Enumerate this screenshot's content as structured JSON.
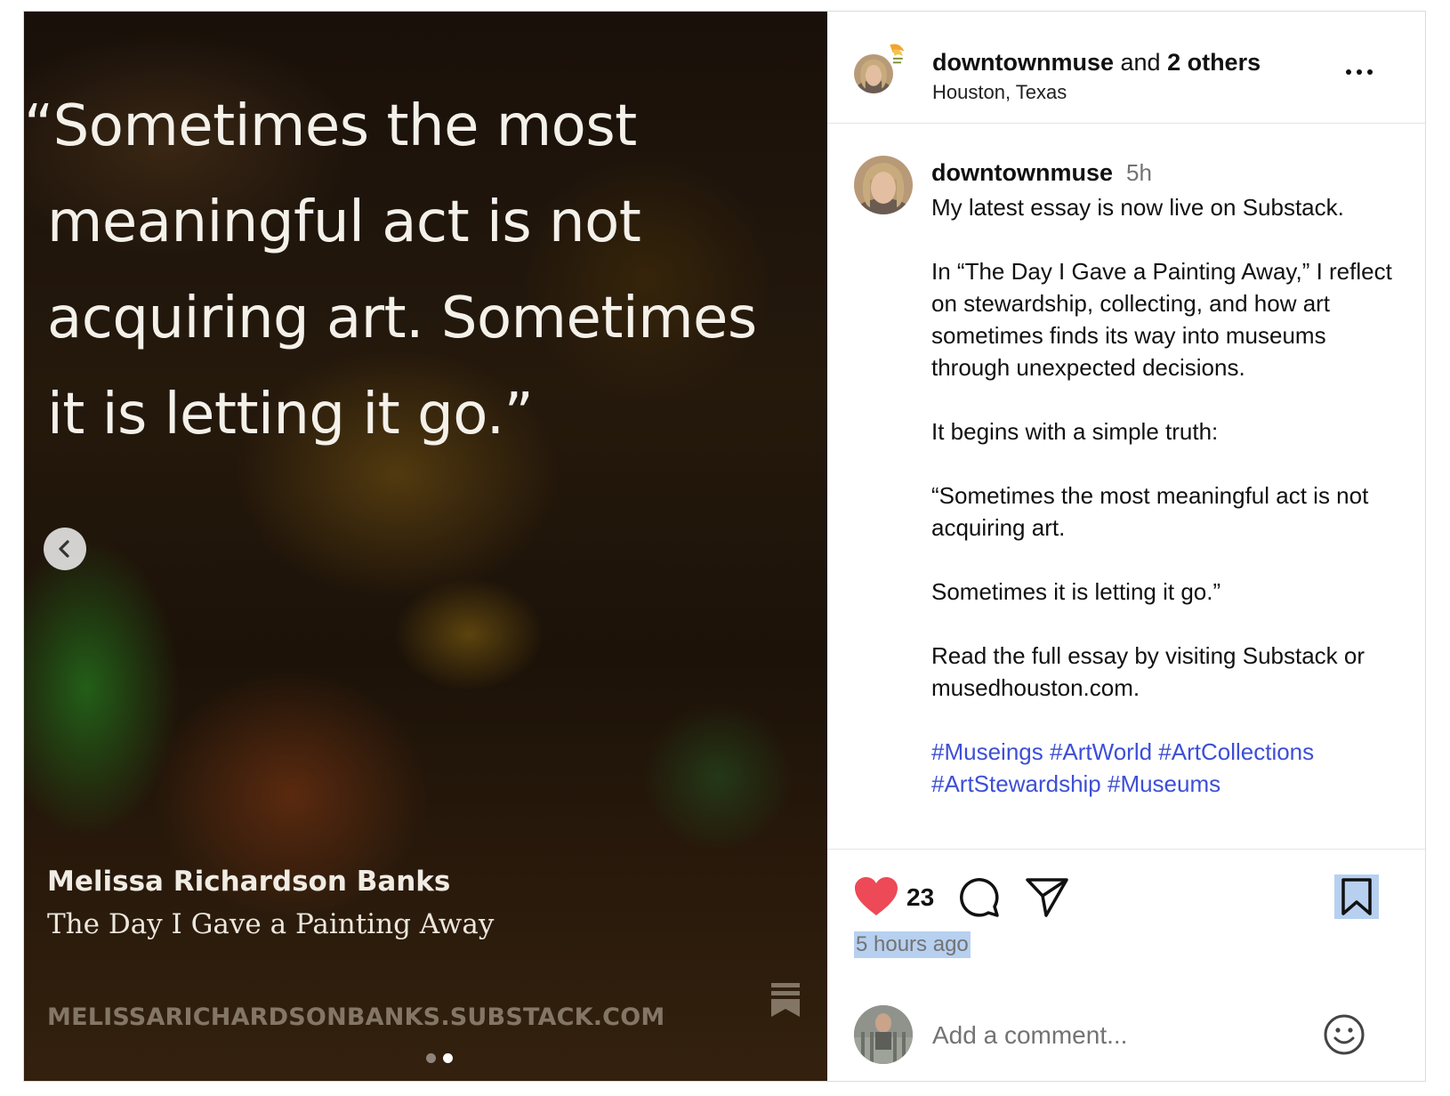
{
  "media": {
    "quote_lines": [
      "“Sometimes the most",
      "meaningful act is not",
      "acquiring art. Sometimes",
      "it is letting it go.”"
    ],
    "author": "Melissa Richardson Banks",
    "essay_title": "The Day I Gave a Painting Away",
    "site": "MELISSARICHARDSONBANKS.SUBSTACK.COM",
    "prev_icon": "chevron-left-icon",
    "slide_count": 2,
    "active_slide": 2
  },
  "header": {
    "username": "downtownmuse",
    "joiner": " and ",
    "others": "2 others",
    "location": "Houston, Texas",
    "more_icon": "more-horizontal-icon"
  },
  "comment": {
    "username": "downtownmuse",
    "time": "5h",
    "paragraphs": [
      "My latest essay is now live on Substack.",
      "In “The Day I Gave a Painting Away,” I reflect on stewardship, collecting, and how art sometimes finds its way into museums through unexpected decisions.",
      "It begins with a simple truth:",
      "“Sometimes the most meaningful act is not acquiring art.",
      "Sometimes it is letting it go.”",
      "Read the full essay by visiting Substack or musedhouston.com."
    ],
    "hashtags": "#Museings #ArtWorld #ArtCollections #ArtStewardship #Museums"
  },
  "actions": {
    "like_count": "23",
    "liked": true,
    "time_ago": "5 hours ago",
    "comment_placeholder": "Add a comment...",
    "colors": {
      "like": "#ed4956",
      "hashtag": "#3d4fd6",
      "highlight": "#b7d0f0"
    }
  }
}
